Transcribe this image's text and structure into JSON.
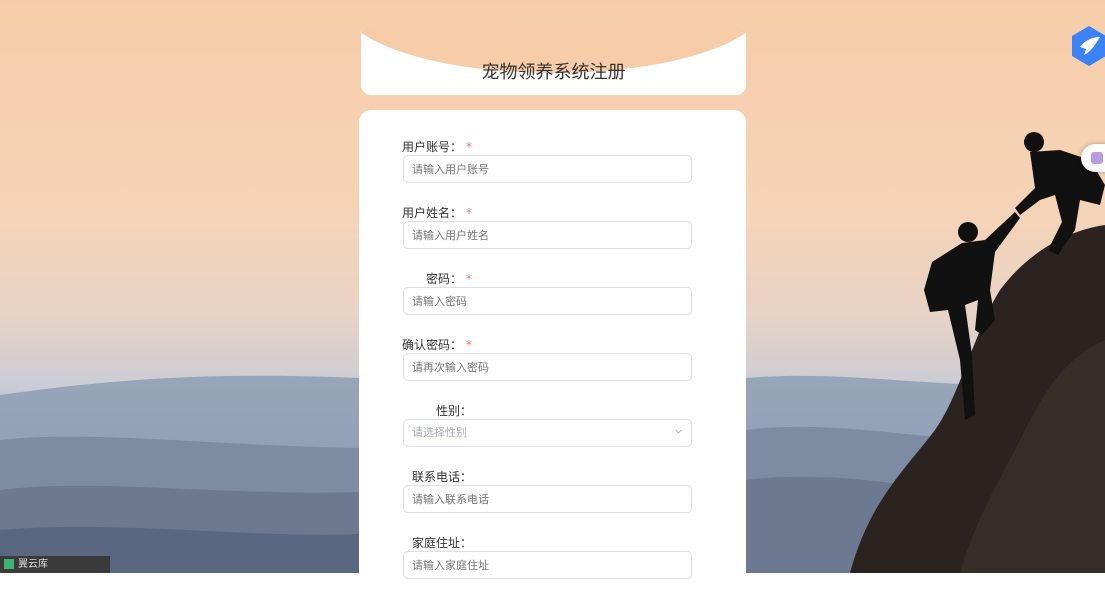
{
  "title": "宠物领养系统注册",
  "fields": [
    {
      "label": "用户账号：",
      "required": "*",
      "placeholder": "请输入用户账号"
    },
    {
      "label": "用户姓名：",
      "required": "*",
      "placeholder": "请输入用户姓名"
    },
    {
      "label": "密码：",
      "required": "*",
      "placeholder": "请输入密码"
    },
    {
      "label": "确认密码：",
      "required": "*",
      "placeholder": "请再次输入密码"
    },
    {
      "label": "性别：",
      "required": "",
      "placeholder": "请选择性别",
      "type": "select"
    },
    {
      "label": "联系电话：",
      "required": "",
      "placeholder": "请输入联系电话"
    },
    {
      "label": "家庭住址：",
      "required": "",
      "placeholder": "请输入家庭住址"
    }
  ],
  "taskbar": {
    "label": "翼云库"
  },
  "colors": {
    "accent": "#409eff",
    "required": "#f56c6c",
    "sky": "#f7cda9"
  }
}
